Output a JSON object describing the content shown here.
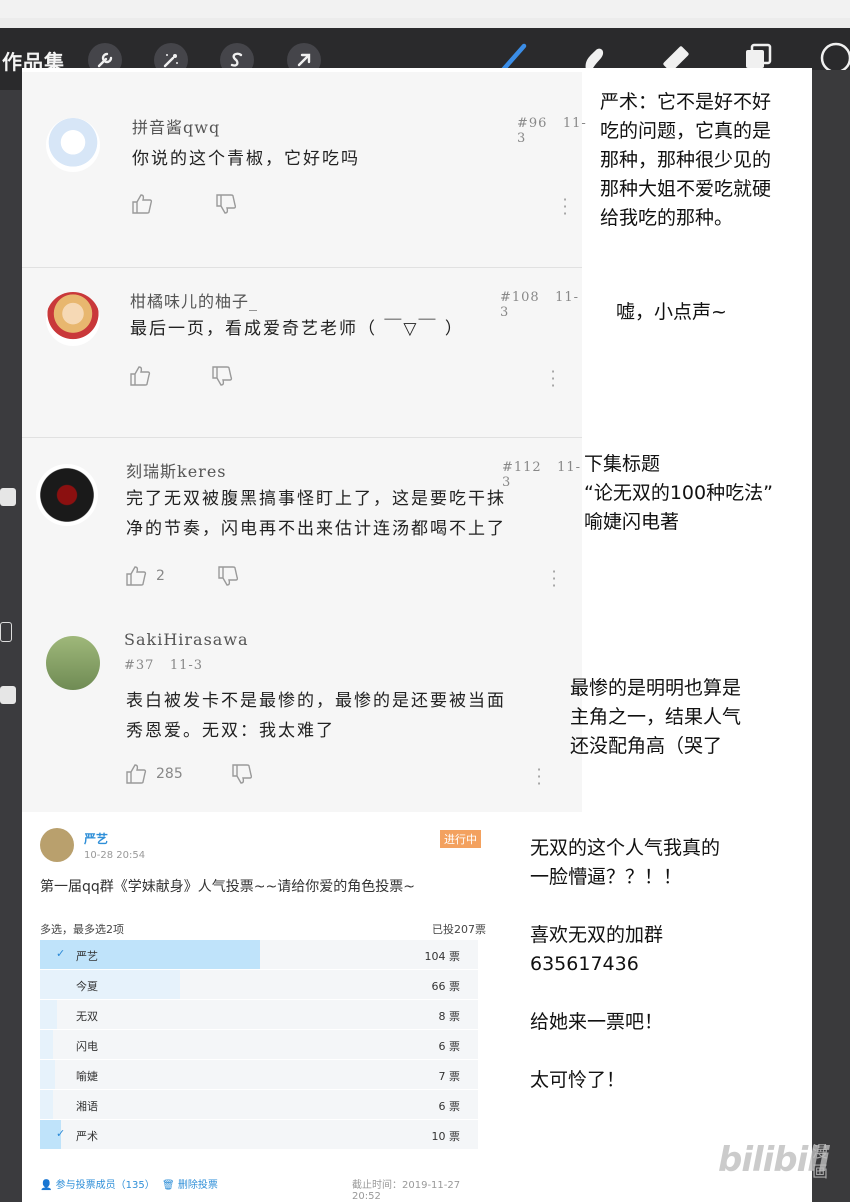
{
  "app": {
    "gallery_label": "作品集",
    "toolbar_left_icons": [
      "wrench-icon",
      "magic-wand-icon",
      "selection-s-icon",
      "arrow-icon"
    ],
    "toolbar_right_icons": [
      "brush-icon",
      "smudge-icon",
      "eraser-icon",
      "layers-icon",
      "color-circle-icon"
    ]
  },
  "comments": [
    {
      "user": "拼音酱qwq",
      "floor": "#96",
      "date": "11-3",
      "text_lines": [
        "你说的这个青椒，它好吃吗"
      ],
      "likes": ""
    },
    {
      "user": "柑橘味儿的柚子_",
      "floor": "#108",
      "date": "11-3",
      "text_lines": [
        "最后一页，看成爱奇艺老师（ ￣▽￣ ）"
      ],
      "likes": ""
    },
    {
      "user": "刻瑞斯keres",
      "floor": "#112",
      "date": "11-3",
      "text_lines": [
        "完了无双被腹黑搞事怪盯上了，这是要吃干抹",
        "净的节奏，闪电再不出来估计连汤都喝不上了"
      ],
      "likes": "2"
    },
    {
      "user": "SakiHirasawa",
      "floor": "#37",
      "date": "11-3",
      "text_lines": [
        "表白被发卡不是最惨的，最惨的是还要被当面",
        "秀恩爱。无双：我太难了"
      ],
      "likes": "285"
    }
  ],
  "notes": [
    [
      "严术：它不是好不好",
      "吃的问题，它真的是",
      "那种，那种很少见的",
      "那种大姐不爱吃就硬",
      "给我吃的那种。"
    ],
    [
      "嘘，小点声~"
    ],
    [
      "下集标题",
      " “论无双的100种吃法”",
      "喻婕闪电著"
    ],
    [
      "最惨的是明明也算是",
      "主角之一，结果人气",
      "还没配角高（哭了"
    ],
    [
      "无双的这个人气我真的",
      "一脸懵逼？？！！",
      "",
      "喜欢无双的加群",
      "635617436",
      "",
      "给她来一票吧！",
      "",
      "太可怜了！"
    ]
  ],
  "poll": {
    "author": "严艺",
    "date": "10-28 20:54",
    "status": "进行中",
    "title": "第一届qq群《学妹献身》人气投票~~请给你爱的角色投票~",
    "mode": "多选，最多选2项",
    "total": "已投207票",
    "options": [
      {
        "label": "严艺",
        "count": "104 票",
        "votes": 104,
        "checked": true
      },
      {
        "label": "今夏",
        "count": "66 票",
        "votes": 66,
        "checked": false
      },
      {
        "label": "无双",
        "count": "8 票",
        "votes": 8,
        "checked": false
      },
      {
        "label": "闪电",
        "count": "6 票",
        "votes": 6,
        "checked": false
      },
      {
        "label": "喻婕",
        "count": "7 票",
        "votes": 7,
        "checked": false
      },
      {
        "label": "湘语",
        "count": "6 票",
        "votes": 6,
        "checked": false
      },
      {
        "label": "严术",
        "count": "10 票",
        "votes": 10,
        "checked": true
      }
    ],
    "max_votes": 207,
    "checkmark": "✓",
    "members": "参与投票成员（135）",
    "delete": "删除投票",
    "deadline": "截止时间：2019-11-27 20:52",
    "fill_colors": {
      "checked": "#bfe3fa",
      "unchecked": "#e6f2fb"
    }
  },
  "watermark": {
    "main": "bilibili",
    "sub": "漫画"
  }
}
